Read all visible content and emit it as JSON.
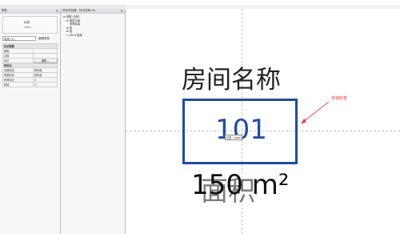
{
  "window": {
    "title_text": ""
  },
  "properties_panel": {
    "header": "属性",
    "type_name": "标签",
    "type_sub": "Label",
    "selector_value": "房间 (1)",
    "edit_type_button": "编辑类型",
    "rows": [
      {
        "label": "标识数据",
        "value": "",
        "group": true
      },
      {
        "label": "图像",
        "value": ""
      },
      {
        "label": "注释",
        "value": ""
      },
      {
        "label": "标记",
        "value": "编辑...",
        "edit": true
      },
      {
        "label": "阶段化",
        "value": "",
        "group": true
      },
      {
        "label": "设置阶段",
        "value": "新构造"
      },
      {
        "label": "所属阶段",
        "value": "新构造"
      },
      {
        "label": "房间标记",
        "value": "☑"
      },
      {
        "label": "其他",
        "value": "☑"
      }
    ]
  },
  "browser_panel": {
    "header": "项目浏览器 - 标记范例.rfa",
    "items": [
      {
        "label": "视图 (全部)",
        "level": 0
      },
      {
        "label": "楼层平面",
        "level": 1
      },
      {
        "label": "参照标高",
        "level": 2
      },
      {
        "label": "族",
        "level": 1
      },
      {
        "label": "组",
        "level": 1
      },
      {
        "label": "Revit 链接",
        "level": 1
      }
    ]
  },
  "canvas": {
    "room_name": "房间名称",
    "room_number": "101",
    "tooltip": "标签 : Label",
    "area_text": "150 m²",
    "area_ghost": "面积",
    "annotation": "单独标签"
  },
  "colors": {
    "room_box": "#1f4e9c",
    "annotation": "#e83a3a"
  }
}
